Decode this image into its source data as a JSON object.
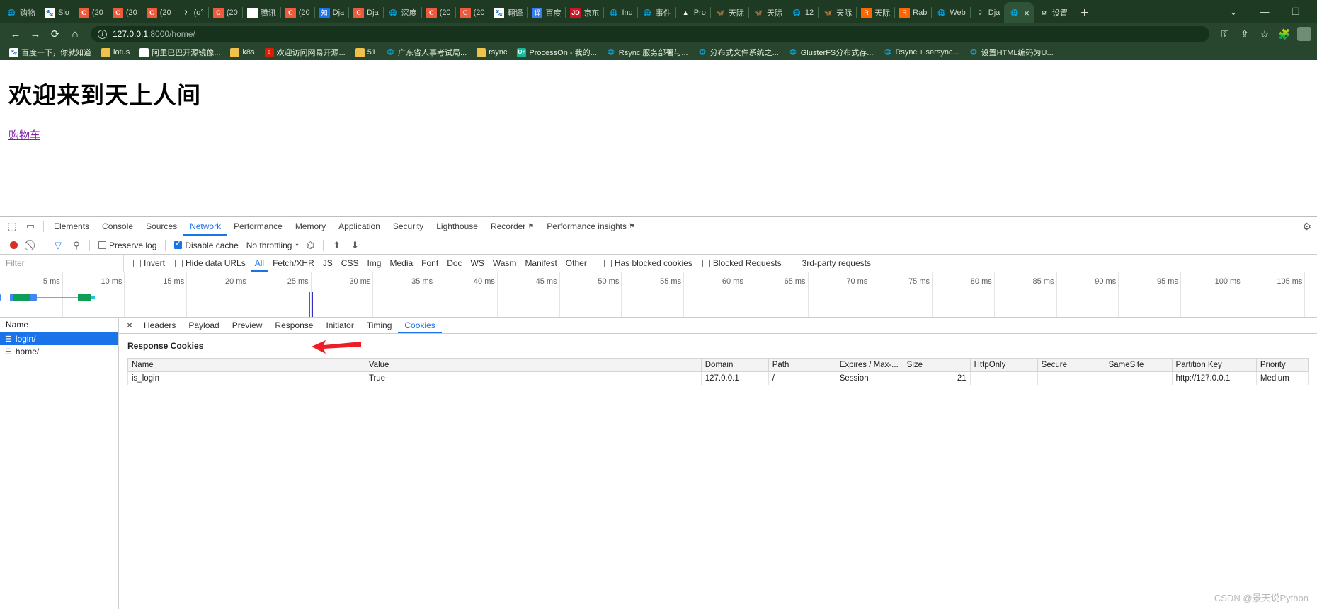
{
  "browser": {
    "tabs": [
      {
        "icon": "globe-icon",
        "label": "购物"
      },
      {
        "icon": "baidu-icon",
        "label": "Slo"
      },
      {
        "icon": "csdn-icon",
        "label": "(20"
      },
      {
        "icon": "csdn-icon",
        "label": "(20"
      },
      {
        "icon": "csdn-icon",
        "label": "(20"
      },
      {
        "icon": "django-icon",
        "label": "(o°"
      },
      {
        "icon": "csdn-icon",
        "label": "(20"
      },
      {
        "icon": "mail-icon",
        "label": "腾讯"
      },
      {
        "icon": "csdn-icon",
        "label": "(20"
      },
      {
        "icon": "zhihu-icon",
        "label": "Dja"
      },
      {
        "icon": "csdn-icon",
        "label": "Dja"
      },
      {
        "icon": "globe-icon",
        "label": "深度"
      },
      {
        "icon": "csdn-icon",
        "label": "(20"
      },
      {
        "icon": "csdn-icon",
        "label": "(20"
      },
      {
        "icon": "baidu-icon",
        "label": "翻译"
      },
      {
        "icon": "translate-icon",
        "label": "百度"
      },
      {
        "icon": "jd-icon",
        "label": "京东"
      },
      {
        "icon": "globe-icon",
        "label": "Ind"
      },
      {
        "icon": "globe-icon",
        "label": "事件"
      },
      {
        "icon": "gitlab-icon",
        "label": "Pro"
      },
      {
        "icon": "butterfly-icon",
        "label": "天际"
      },
      {
        "icon": "butterfly-icon",
        "label": "天际"
      },
      {
        "icon": "globe-icon",
        "label": "12"
      },
      {
        "icon": "butterfly-icon",
        "label": "天际"
      },
      {
        "icon": "rabbit-icon",
        "label": "天际"
      },
      {
        "icon": "rabbit-icon",
        "label": "Rab"
      },
      {
        "icon": "globe-icon",
        "label": "Web"
      },
      {
        "icon": "django-icon",
        "label": "Dja"
      },
      {
        "icon": "globe-icon",
        "label": "",
        "active": true
      },
      {
        "icon": "gear-icon",
        "label": "设置"
      }
    ],
    "new_tab_label": "+",
    "tab_close_label": "×",
    "window_controls": {
      "minimize": "—",
      "maximize": "❐",
      "list": "⌄"
    },
    "nav": {
      "back": "←",
      "forward": "→",
      "reload": "⟳",
      "home": "⌂"
    },
    "omnibox": {
      "info_icon": "i",
      "url_host": "127.0.0.1",
      "url_rest": ":8000/home/"
    },
    "toolbar_right": {
      "key_icon": "⚿",
      "share_icon": "⇪",
      "bookmark_icon": "☆",
      "extensions_icon": "🧩",
      "menu_icon": "⋮"
    },
    "bookmarks": [
      {
        "icon": "baidu-icon",
        "label": "百度一下，你就知道"
      },
      {
        "icon": "folder-icon",
        "label": "lotus"
      },
      {
        "icon": "ali-icon",
        "label": "阿里巴巴开源镜像..."
      },
      {
        "icon": "folder-icon",
        "label": "k8s"
      },
      {
        "icon": "netease-icon",
        "label": "欢迎访问网易开源..."
      },
      {
        "icon": "folder-icon",
        "label": "51"
      },
      {
        "icon": "globe-icon",
        "label": "广东省人事考试局..."
      },
      {
        "icon": "folder-icon",
        "label": "rsync"
      },
      {
        "icon": "processon-icon",
        "label": "ProcessOn - 我的..."
      },
      {
        "icon": "doc-icon",
        "label": "Rsync 服务部署与..."
      },
      {
        "icon": "doc-icon",
        "label": "分布式文件系统之..."
      },
      {
        "icon": "doc-icon",
        "label": "GlusterFS分布式存..."
      },
      {
        "icon": "doc-icon",
        "label": "Rsync + sersync..."
      },
      {
        "icon": "doc-icon",
        "label": "设置HTML编码为U..."
      }
    ]
  },
  "page": {
    "heading": "欢迎来到天上人间",
    "link": "购物车"
  },
  "devtools": {
    "panel_tabs": [
      {
        "label": "Elements"
      },
      {
        "label": "Console"
      },
      {
        "label": "Sources"
      },
      {
        "label": "Network",
        "active": true
      },
      {
        "label": "Performance"
      },
      {
        "label": "Memory"
      },
      {
        "label": "Application"
      },
      {
        "label": "Security"
      },
      {
        "label": "Lighthouse"
      },
      {
        "label": "Recorder",
        "warn": "⚑"
      },
      {
        "label": "Performance insights",
        "warn": "⚑"
      }
    ],
    "settings_icon": "⚙",
    "inspect_icon": "⬚",
    "device_icon": "▭",
    "toolbar": {
      "record_label": "",
      "clear_label": "⃠",
      "filter_label": "▽",
      "search_label": "⚲",
      "preserve_log": "Preserve log",
      "preserve_log_checked": false,
      "disable_cache": "Disable cache",
      "disable_cache_checked": true,
      "throttling": "No throttling",
      "throttle_caret": "▾",
      "wifi_icon": "⌬",
      "import_icon": "⬆",
      "export_icon": "⬇"
    },
    "filterbar": {
      "placeholder": "Filter",
      "invert": "Invert",
      "hide_data_urls": "Hide data URLs",
      "types": [
        "All",
        "Fetch/XHR",
        "JS",
        "CSS",
        "Img",
        "Media",
        "Font",
        "Doc",
        "WS",
        "Wasm",
        "Manifest",
        "Other"
      ],
      "selected_type": "All",
      "has_blocked_cookies": "Has blocked cookies",
      "blocked_requests": "Blocked Requests",
      "third_party_requests": "3rd-party requests"
    },
    "timeline": {
      "ticks": [
        "5 ms",
        "10 ms",
        "15 ms",
        "20 ms",
        "25 ms",
        "30 ms",
        "35 ms",
        "40 ms",
        "45 ms",
        "50 ms",
        "55 ms",
        "60 ms",
        "65 ms",
        "70 ms",
        "75 ms",
        "80 ms",
        "85 ms",
        "90 ms",
        "95 ms",
        "100 ms",
        "105 ms"
      ]
    },
    "requests": {
      "column_header": "Name",
      "rows": [
        {
          "name": "login/",
          "selected": true,
          "icon": "document-icon"
        },
        {
          "name": "home/",
          "selected": false,
          "icon": "document-icon"
        }
      ]
    },
    "detail": {
      "close_label": "✕",
      "tabs": [
        {
          "label": "Headers"
        },
        {
          "label": "Payload"
        },
        {
          "label": "Preview"
        },
        {
          "label": "Response"
        },
        {
          "label": "Initiator"
        },
        {
          "label": "Timing"
        },
        {
          "label": "Cookies",
          "active": true
        }
      ],
      "section_title": "Response Cookies",
      "cookies_table": {
        "columns": [
          "Name",
          "Value",
          "Domain",
          "Path",
          "Expires / Max-...",
          "Size",
          "HttpOnly",
          "Secure",
          "SameSite",
          "Partition Key",
          "Priority"
        ],
        "rows": [
          {
            "Name": "is_login",
            "Value": "True",
            "Domain": "127.0.0.1",
            "Path": "/",
            "Expires / Max-...": "Session",
            "Size": "21",
            "HttpOnly": "",
            "Secure": "",
            "SameSite": "",
            "Partition Key": "http://127.0.0.1",
            "Priority": "Medium"
          }
        ]
      }
    }
  },
  "watermark": "CSDN @景天说Python",
  "colors": {
    "chrome_theme": "#27462d",
    "chrome_tabstrip": "#1e3a23",
    "devtools_accent": "#1a73e8",
    "record_red": "#d93025",
    "arrow_red": "#ee1c25"
  }
}
